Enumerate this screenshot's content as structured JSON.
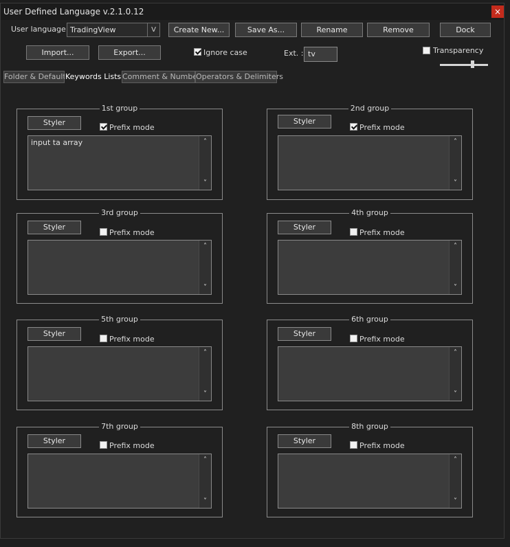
{
  "window": {
    "title": "User Defined Language v.2.1.0.12",
    "close_glyph": "×"
  },
  "toolbar": {
    "user_language_label": "User language :",
    "user_language_value": "TradingView",
    "combo_arrow": "V",
    "create_new": "Create New...",
    "save_as": "Save As...",
    "rename": "Rename",
    "remove": "Remove",
    "dock": "Dock",
    "import": "Import...",
    "export": "Export...",
    "ignore_case_label": "Ignore case",
    "ignore_case_checked": true,
    "ext_label": "Ext. :",
    "ext_value": "tv",
    "transparency_label": "Transparency",
    "transparency_checked": false,
    "transparency_level": 0.67
  },
  "tabs": [
    {
      "label": "Folder & Default",
      "active": false
    },
    {
      "label": "Keywords Lists",
      "active": true
    },
    {
      "label": "Comment & Number",
      "active": false
    },
    {
      "label": "Operators & Delimiters",
      "active": false
    }
  ],
  "groups": [
    {
      "title": "1st group",
      "styler": "Styler",
      "prefix_label": "Prefix mode",
      "prefix_checked": true,
      "keywords": "input ta array"
    },
    {
      "title": "2nd group",
      "styler": "Styler",
      "prefix_label": "Prefix mode",
      "prefix_checked": true,
      "keywords": ""
    },
    {
      "title": "3rd group",
      "styler": "Styler",
      "prefix_label": "Prefix mode",
      "prefix_checked": false,
      "keywords": ""
    },
    {
      "title": "4th group",
      "styler": "Styler",
      "prefix_label": "Prefix mode",
      "prefix_checked": false,
      "keywords": ""
    },
    {
      "title": "5th group",
      "styler": "Styler",
      "prefix_label": "Prefix mode",
      "prefix_checked": false,
      "keywords": ""
    },
    {
      "title": "6th group",
      "styler": "Styler",
      "prefix_label": "Prefix mode",
      "prefix_checked": false,
      "keywords": ""
    },
    {
      "title": "7th group",
      "styler": "Styler",
      "prefix_label": "Prefix mode",
      "prefix_checked": false,
      "keywords": ""
    },
    {
      "title": "8th group",
      "styler": "Styler",
      "prefix_label": "Prefix mode",
      "prefix_checked": false,
      "keywords": ""
    }
  ],
  "scroll_glyphs": {
    "up": "˄",
    "down": "˅"
  }
}
